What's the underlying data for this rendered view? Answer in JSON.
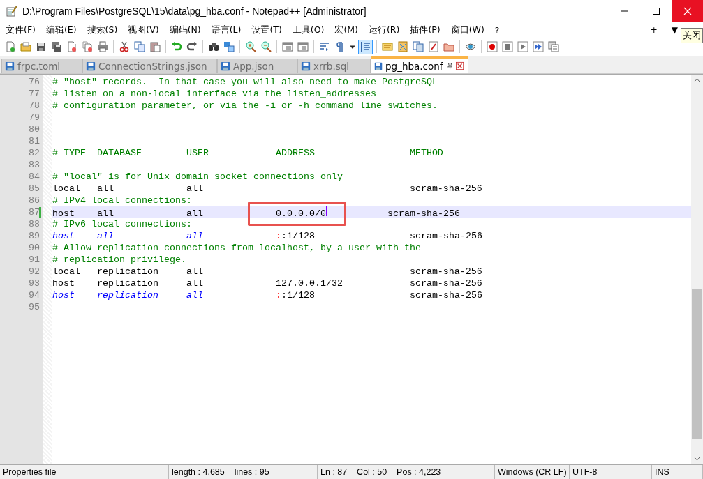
{
  "window": {
    "title": "D:\\Program Files\\PostgreSQL\\15\\data\\pg_hba.conf - Notepad++ [Administrator]"
  },
  "menu": [
    "文件(F)",
    "编辑(E)",
    "搜索(S)",
    "视图(V)",
    "编码(N)",
    "语言(L)",
    "设置(T)",
    "工具(O)",
    "宏(M)",
    "运行(R)",
    "插件(P)",
    "窗口(W)",
    "?"
  ],
  "menu_extras": [
    "+",
    "▼"
  ],
  "tooltip": "关闭",
  "toolbar": [
    {
      "kind": "new",
      "selected": false
    },
    {
      "kind": "open",
      "selected": false
    },
    {
      "kind": "save",
      "selected": false
    },
    {
      "kind": "saveall",
      "selected": false
    },
    {
      "kind": "close",
      "selected": false
    },
    {
      "kind": "closeall",
      "selected": false
    },
    {
      "kind": "print",
      "selected": false
    },
    {
      "kind": "sep"
    },
    {
      "kind": "cut",
      "selected": false
    },
    {
      "kind": "copy",
      "selected": false
    },
    {
      "kind": "paste",
      "selected": false
    },
    {
      "kind": "sep"
    },
    {
      "kind": "undo",
      "selected": false
    },
    {
      "kind": "redo",
      "selected": false
    },
    {
      "kind": "sep"
    },
    {
      "kind": "find",
      "selected": false
    },
    {
      "kind": "replace",
      "selected": false
    },
    {
      "kind": "sep"
    },
    {
      "kind": "zoomin",
      "selected": false
    },
    {
      "kind": "zoomout",
      "selected": false
    },
    {
      "kind": "sep"
    },
    {
      "kind": "window",
      "selected": false
    },
    {
      "kind": "window",
      "selected": false
    },
    {
      "kind": "sep"
    },
    {
      "kind": "wrap",
      "selected": false
    },
    {
      "kind": "pilcrow",
      "selected": false
    },
    {
      "kind": "caret",
      "selected": false
    },
    {
      "kind": "indent",
      "selected": true
    },
    {
      "kind": "sep"
    },
    {
      "kind": "doc",
      "selected": false
    },
    {
      "kind": "map",
      "selected": false
    },
    {
      "kind": "docs",
      "selected": false
    },
    {
      "kind": "fn",
      "selected": false
    },
    {
      "kind": "folder",
      "selected": false
    },
    {
      "kind": "sep"
    },
    {
      "kind": "eye",
      "selected": false
    },
    {
      "kind": "sep"
    },
    {
      "kind": "record",
      "selected": false
    },
    {
      "kind": "stop",
      "selected": false
    },
    {
      "kind": "play",
      "selected": false
    },
    {
      "kind": "ff",
      "selected": false
    },
    {
      "kind": "macrolist",
      "selected": false
    }
  ],
  "tabs": [
    {
      "label": "frpc.toml",
      "selected": false
    },
    {
      "label": "ConnectionStrings.json",
      "selected": false
    },
    {
      "label": "App.json",
      "selected": false
    },
    {
      "label": "xrrb.sql",
      "selected": false
    },
    {
      "label": "pg_hba.conf",
      "selected": true
    }
  ],
  "editor": {
    "lines": [
      {
        "number": "76",
        "segments": [
          {
            "kind": "comment",
            "text": "# \"host\" records.  In that case you will also need to make PostgreSQL"
          }
        ]
      },
      {
        "number": "77",
        "segments": [
          {
            "kind": "comment",
            "text": "# listen on a non-local interface via the listen_addresses"
          }
        ]
      },
      {
        "number": "78",
        "segments": [
          {
            "kind": "comment",
            "text": "# configuration parameter, or via the -i or -h command line switches."
          }
        ]
      },
      {
        "number": "79"
      },
      {
        "number": "80"
      },
      {
        "number": "81"
      },
      {
        "number": "82",
        "segments": [
          {
            "kind": "comment",
            "text": "# TYPE  DATABASE        USER            ADDRESS                 METHOD"
          }
        ]
      },
      {
        "number": "83"
      },
      {
        "number": "84",
        "segments": [
          {
            "kind": "comment",
            "text": "# \"local\" is for Unix domain socket connections only"
          }
        ]
      },
      {
        "number": "85",
        "segments": [
          {
            "kind": "text",
            "text": "local   all             all                                     scram-sha-256"
          }
        ]
      },
      {
        "number": "86",
        "segments": [
          {
            "kind": "comment",
            "text": "# IPv4 local connections:"
          }
        ]
      },
      {
        "number": "87",
        "current": true,
        "change_mark": true,
        "segments": [
          {
            "kind": "text",
            "text": "host    all             all             "
          },
          {
            "kind": "text",
            "text": "0.0.0.0/0",
            "boxed": true,
            "caret_after": true
          },
          {
            "kind": "text",
            "text": "           scram-sha-256"
          }
        ]
      },
      {
        "number": "88",
        "segments": [
          {
            "kind": "comment",
            "text": "# IPv6 local connections:"
          }
        ]
      },
      {
        "number": "89",
        "segments": [
          {
            "kind": "keyword",
            "text": "host    "
          },
          {
            "kind": "keyword",
            "text": "all             "
          },
          {
            "kind": "keyword",
            "text": "all             "
          },
          {
            "kind": "op",
            "text": ":"
          },
          {
            "kind": "text",
            "text": ":1/128                 scram-sha-256"
          }
        ]
      },
      {
        "number": "90",
        "segments": [
          {
            "kind": "comment",
            "text": "# Allow replication connections from localhost, by a user with the"
          }
        ]
      },
      {
        "number": "91",
        "segments": [
          {
            "kind": "comment",
            "text": "# replication privilege."
          }
        ]
      },
      {
        "number": "92",
        "segments": [
          {
            "kind": "text",
            "text": "local   replication     all                                     scram-sha-256"
          }
        ]
      },
      {
        "number": "93",
        "segments": [
          {
            "kind": "text",
            "text": "host    replication     all             127.0.0.1/32            scram-sha-256"
          }
        ]
      },
      {
        "number": "94",
        "segments": [
          {
            "kind": "keyword",
            "text": "host    "
          },
          {
            "kind": "keyword",
            "text": "replication     "
          },
          {
            "kind": "keyword",
            "text": "all             "
          },
          {
            "kind": "op",
            "text": ":"
          },
          {
            "kind": "text",
            "text": ":1/128                 scram-sha-256"
          }
        ]
      },
      {
        "number": "95"
      }
    ]
  },
  "status_bar": [
    "Properties file",
    "length : 4,685    lines : 95",
    "Ln : 87    Col : 50    Pos : 4,223",
    "Windows (CR LF)",
    "UTF-8",
    "INS"
  ]
}
